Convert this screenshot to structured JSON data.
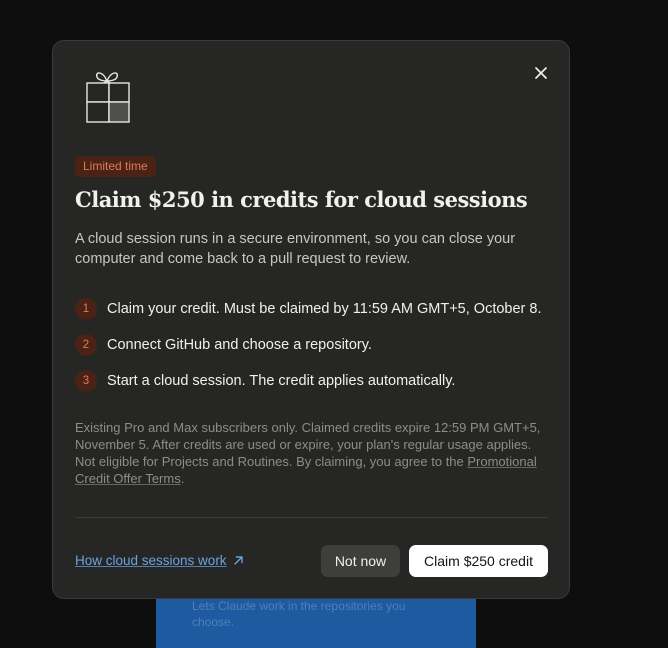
{
  "background": {
    "card_text": "Lets Claude work in the repositories you choose."
  },
  "modal": {
    "badge": "Limited time",
    "title": "Claim $250 in credits for cloud sessions",
    "description": "A cloud session runs in a secure environment, so you can close your computer and come back to a pull request to review.",
    "steps": [
      {
        "number": "1",
        "text": "Claim your credit. Must be claimed by 11:59 AM GMT+5, October 8."
      },
      {
        "number": "2",
        "text": "Connect GitHub and choose a repository."
      },
      {
        "number": "3",
        "text": "Start a cloud session. The credit applies automatically."
      }
    ],
    "fine_print": "Existing Pro and Max subscribers only. Claimed credits expire 12:59 PM GMT+5, November 5. After credits are used or expire, your plan's regular usage applies. Not eligible for Projects and Routines. By claiming, you agree to the ",
    "terms_link": "Promotional Credit Offer Terms",
    "fine_print_end": ".",
    "how_link": "How cloud sessions work",
    "not_now_label": "Not now",
    "claim_label": "Claim $250 credit"
  },
  "icons": {
    "close": "close-icon",
    "gift": "gift-icon",
    "external": "arrow-up-right-icon"
  },
  "colors": {
    "accent": "#e07a55",
    "badge_bg": "#4a2216",
    "link": "#6ba3e0",
    "modal_bg": "#262625"
  }
}
